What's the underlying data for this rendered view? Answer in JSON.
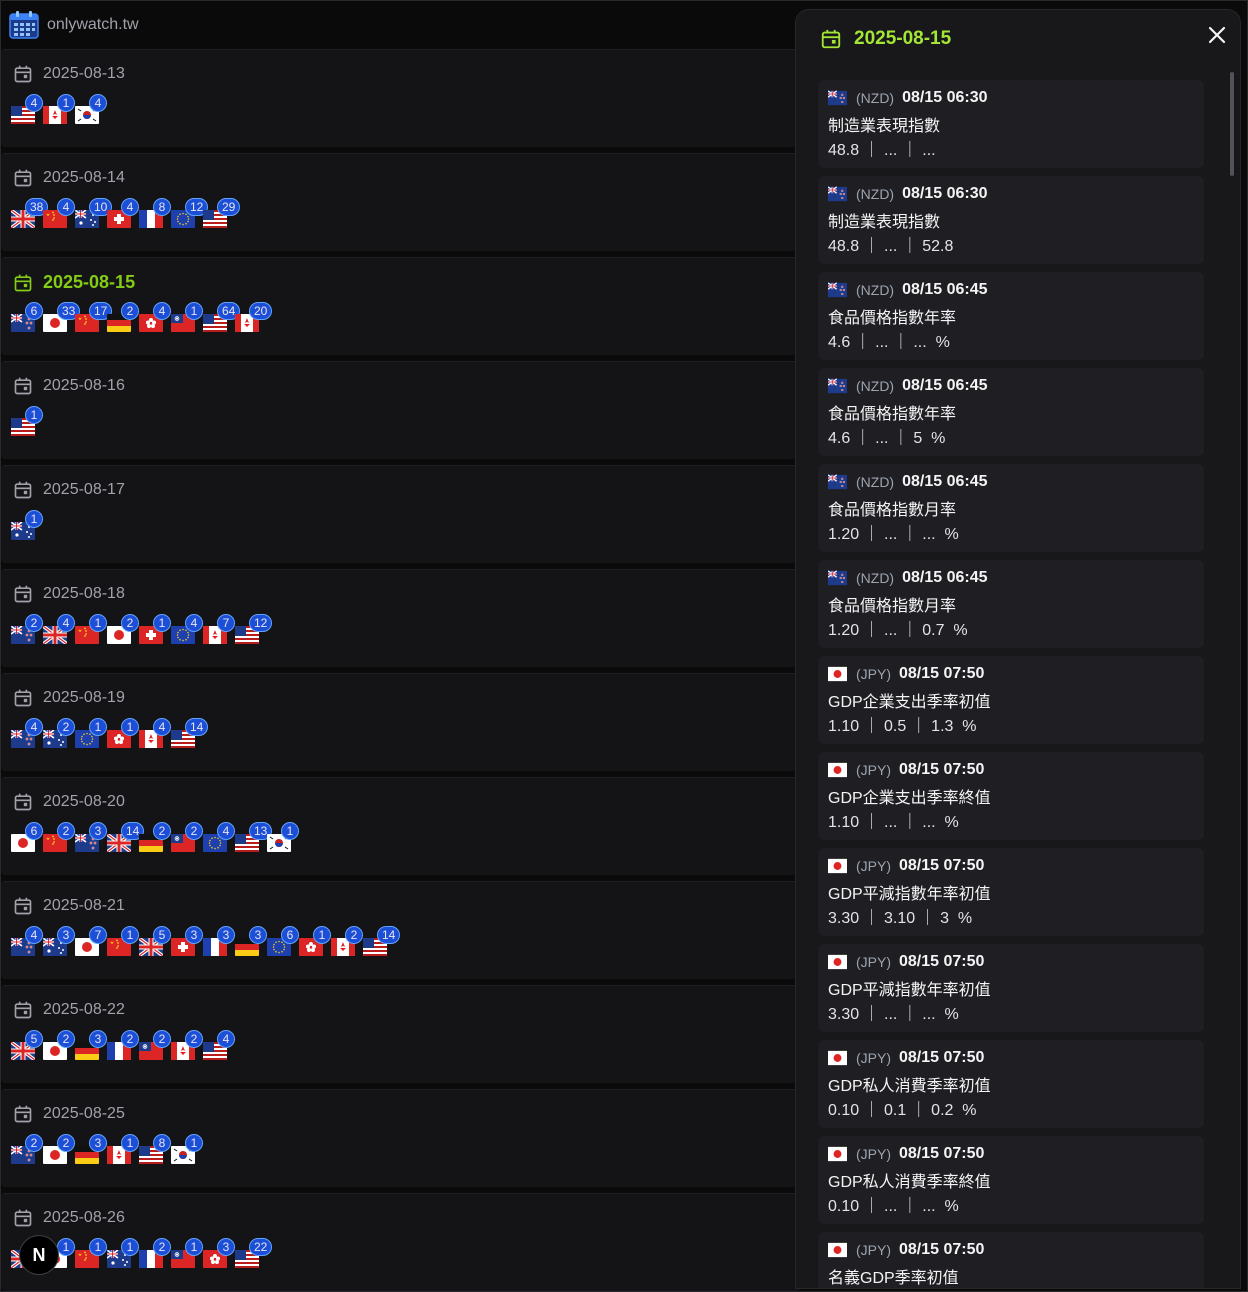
{
  "site": {
    "name": "onlywatch.tw"
  },
  "days": [
    {
      "date": "2025-08-13",
      "active": false,
      "flags": [
        {
          "c": "us",
          "n": "4"
        },
        {
          "c": "ca",
          "n": "1"
        },
        {
          "c": "kr",
          "n": "4"
        }
      ]
    },
    {
      "date": "2025-08-14",
      "active": false,
      "flags": [
        {
          "c": "gb",
          "n": "38"
        },
        {
          "c": "cn",
          "n": "4"
        },
        {
          "c": "au",
          "n": "10"
        },
        {
          "c": "ch",
          "n": "4"
        },
        {
          "c": "fr",
          "n": "8"
        },
        {
          "c": "eu",
          "n": "12"
        },
        {
          "c": "us",
          "n": "29"
        }
      ]
    },
    {
      "date": "2025-08-15",
      "active": true,
      "flags": [
        {
          "c": "nz",
          "n": "6"
        },
        {
          "c": "jp",
          "n": "33"
        },
        {
          "c": "cn",
          "n": "17"
        },
        {
          "c": "de",
          "n": "2"
        },
        {
          "c": "hk",
          "n": "4"
        },
        {
          "c": "tw",
          "n": "1"
        },
        {
          "c": "us",
          "n": "64"
        },
        {
          "c": "ca",
          "n": "20"
        }
      ]
    },
    {
      "date": "2025-08-16",
      "active": false,
      "flags": [
        {
          "c": "us",
          "n": "1"
        }
      ]
    },
    {
      "date": "2025-08-17",
      "active": false,
      "flags": [
        {
          "c": "au",
          "n": "1"
        }
      ]
    },
    {
      "date": "2025-08-18",
      "active": false,
      "flags": [
        {
          "c": "nz",
          "n": "2"
        },
        {
          "c": "gb",
          "n": "4"
        },
        {
          "c": "cn",
          "n": "1"
        },
        {
          "c": "jp",
          "n": "2"
        },
        {
          "c": "ch",
          "n": "1"
        },
        {
          "c": "eu",
          "n": "4"
        },
        {
          "c": "ca",
          "n": "7"
        },
        {
          "c": "us",
          "n": "12"
        }
      ]
    },
    {
      "date": "2025-08-19",
      "active": false,
      "flags": [
        {
          "c": "nz",
          "n": "4"
        },
        {
          "c": "au",
          "n": "2"
        },
        {
          "c": "eu",
          "n": "1"
        },
        {
          "c": "hk",
          "n": "1"
        },
        {
          "c": "ca",
          "n": "4"
        },
        {
          "c": "us",
          "n": "14"
        }
      ]
    },
    {
      "date": "2025-08-20",
      "active": false,
      "flags": [
        {
          "c": "jp",
          "n": "6"
        },
        {
          "c": "cn",
          "n": "2"
        },
        {
          "c": "nz",
          "n": "3"
        },
        {
          "c": "gb",
          "n": "14"
        },
        {
          "c": "de",
          "n": "2"
        },
        {
          "c": "tw",
          "n": "2"
        },
        {
          "c": "eu",
          "n": "4"
        },
        {
          "c": "us",
          "n": "13"
        },
        {
          "c": "kr",
          "n": "1"
        }
      ]
    },
    {
      "date": "2025-08-21",
      "active": false,
      "flags": [
        {
          "c": "nz",
          "n": "4"
        },
        {
          "c": "au",
          "n": "3"
        },
        {
          "c": "jp",
          "n": "7"
        },
        {
          "c": "cn",
          "n": "1"
        },
        {
          "c": "gb",
          "n": "5"
        },
        {
          "c": "ch",
          "n": "3"
        },
        {
          "c": "fr",
          "n": "3"
        },
        {
          "c": "de",
          "n": "3"
        },
        {
          "c": "eu",
          "n": "6"
        },
        {
          "c": "hk",
          "n": "1"
        },
        {
          "c": "ca",
          "n": "2"
        },
        {
          "c": "us",
          "n": "14"
        }
      ]
    },
    {
      "date": "2025-08-22",
      "active": false,
      "flags": [
        {
          "c": "gb",
          "n": "5"
        },
        {
          "c": "jp",
          "n": "2"
        },
        {
          "c": "de",
          "n": "3"
        },
        {
          "c": "fr",
          "n": "2"
        },
        {
          "c": "tw",
          "n": "2"
        },
        {
          "c": "ca",
          "n": "2"
        },
        {
          "c": "us",
          "n": "4"
        }
      ]
    },
    {
      "date": "2025-08-25",
      "active": false,
      "flags": [
        {
          "c": "nz",
          "n": "2"
        },
        {
          "c": "jp",
          "n": "2"
        },
        {
          "c": "de",
          "n": "3"
        },
        {
          "c": "ca",
          "n": "1"
        },
        {
          "c": "us",
          "n": "8"
        },
        {
          "c": "kr",
          "n": "1"
        }
      ]
    },
    {
      "date": "2025-08-26",
      "active": false,
      "flags": [
        {
          "c": "gb",
          "n": ""
        },
        {
          "c": "jp",
          "n": "1"
        },
        {
          "c": "cn",
          "n": "1"
        },
        {
          "c": "au",
          "n": "1"
        },
        {
          "c": "fr",
          "n": "2"
        },
        {
          "c": "tw",
          "n": "1"
        },
        {
          "c": "hk",
          "n": "3"
        },
        {
          "c": "us",
          "n": "22"
        }
      ]
    }
  ],
  "panel": {
    "date": "2025-08-15",
    "events": [
      {
        "c": "nz",
        "cur": "(NZD)",
        "time": "08/15 06:30",
        "name": "制造業表現指數",
        "vals": "48.8 ｜ ... ｜ ..."
      },
      {
        "c": "nz",
        "cur": "(NZD)",
        "time": "08/15 06:30",
        "name": "制造業表現指數",
        "vals": "48.8 ｜ ... ｜ 52.8"
      },
      {
        "c": "nz",
        "cur": "(NZD)",
        "time": "08/15 06:45",
        "name": "食品價格指數年率",
        "vals": "4.6 ｜ ... ｜ ...  %"
      },
      {
        "c": "nz",
        "cur": "(NZD)",
        "time": "08/15 06:45",
        "name": "食品價格指數年率",
        "vals": "4.6 ｜ ... ｜ 5  %"
      },
      {
        "c": "nz",
        "cur": "(NZD)",
        "time": "08/15 06:45",
        "name": "食品價格指數月率",
        "vals": "1.20 ｜ ... ｜ ...  %"
      },
      {
        "c": "nz",
        "cur": "(NZD)",
        "time": "08/15 06:45",
        "name": "食品價格指數月率",
        "vals": "1.20 ｜ ... ｜ 0.7  %"
      },
      {
        "c": "jp",
        "cur": "(JPY)",
        "time": "08/15 07:50",
        "name": "GDP企業支出季率初值",
        "vals": "1.10 ｜ 0.5 ｜ 1.3  %"
      },
      {
        "c": "jp",
        "cur": "(JPY)",
        "time": "08/15 07:50",
        "name": "GDP企業支出季率終值",
        "vals": "1.10 ｜ ... ｜ ...  %"
      },
      {
        "c": "jp",
        "cur": "(JPY)",
        "time": "08/15 07:50",
        "name": "GDP平減指數年率初值",
        "vals": "3.30 ｜ 3.10 ｜ 3  %"
      },
      {
        "c": "jp",
        "cur": "(JPY)",
        "time": "08/15 07:50",
        "name": "GDP平減指數年率初值",
        "vals": "3.30 ｜ ... ｜ ...  %"
      },
      {
        "c": "jp",
        "cur": "(JPY)",
        "time": "08/15 07:50",
        "name": "GDP私人消費季率初值",
        "vals": "0.10 ｜ 0.1 ｜ 0.2  %"
      },
      {
        "c": "jp",
        "cur": "(JPY)",
        "time": "08/15 07:50",
        "name": "GDP私人消費季率終值",
        "vals": "0.10 ｜ ... ｜ ...  %"
      },
      {
        "c": "jp",
        "cur": "(JPY)",
        "time": "08/15 07:50",
        "name": "名義GDP季率初值",
        "vals": ""
      }
    ]
  },
  "fab": {
    "label": "N"
  },
  "colors": {
    "active_date": "#84cc16",
    "panel_date": "#a3e635",
    "badge": "#1d4ed8"
  }
}
